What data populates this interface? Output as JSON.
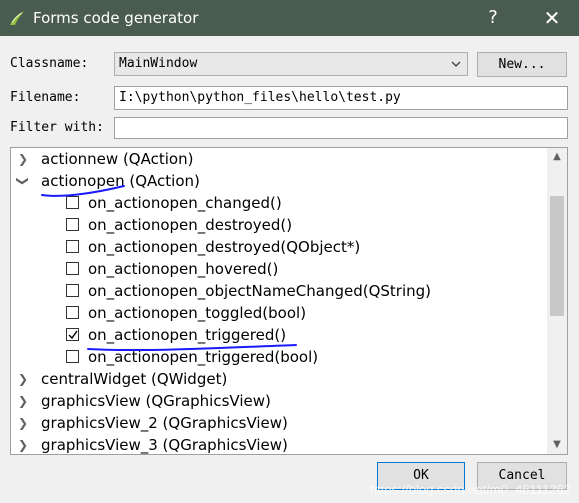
{
  "window": {
    "title": "Forms code generator",
    "help_symbol": "?",
    "close_symbol": "✕"
  },
  "form": {
    "classname_label": "Classname:",
    "classname_value": "MainWindow",
    "new_button": "New...",
    "filename_label": "Filename:",
    "filename_value": "I:\\python\\python_files\\hello\\test.py",
    "filter_label": "Filter with:",
    "filter_value": ""
  },
  "tree": {
    "items": [
      {
        "label": "actionnew (QAction)",
        "expanded": false
      },
      {
        "label": "actionopen (QAction)",
        "expanded": true
      },
      {
        "label": "on_actionopen_changed()",
        "checked": false
      },
      {
        "label": "on_actionopen_destroyed()",
        "checked": false
      },
      {
        "label": "on_actionopen_destroyed(QObject*)",
        "checked": false
      },
      {
        "label": "on_actionopen_hovered()",
        "checked": false
      },
      {
        "label": "on_actionopen_objectNameChanged(QString)",
        "checked": false
      },
      {
        "label": "on_actionopen_toggled(bool)",
        "checked": false
      },
      {
        "label": "on_actionopen_triggered()",
        "checked": true
      },
      {
        "label": "on_actionopen_triggered(bool)",
        "checked": false
      },
      {
        "label": "centralWidget (QWidget)",
        "expanded": false
      },
      {
        "label": "graphicsView (QGraphicsView)",
        "expanded": false
      },
      {
        "label": "graphicsView_2 (QGraphicsView)",
        "expanded": false
      },
      {
        "label": "graphicsView_3 (QGraphicsView)",
        "expanded": false
      }
    ]
  },
  "buttons": {
    "ok": "OK",
    "cancel": "Cancel"
  },
  "watermark": "https://blog.csdn.net/m0_46111262",
  "colors": {
    "titlebar": "#4a5b50",
    "annotation_ink": "#1a1aff",
    "focus_border": "#0078d7"
  }
}
